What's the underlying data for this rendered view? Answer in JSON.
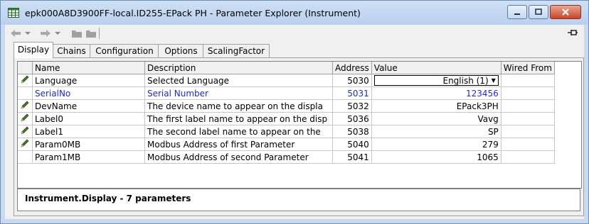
{
  "window": {
    "title": "epk000A8D3900FF-local.ID255-EPack  PH - Parameter Explorer (Instrument)"
  },
  "toolbar": {
    "icons": [
      "back-arrow-icon",
      "dropdown-arrow-icon",
      "forward-arrow-icon",
      "dropdown-arrow-icon",
      "folder-up-icon",
      "folder-icon",
      "pin-icon"
    ]
  },
  "tabs": [
    {
      "label": "Display",
      "active": true
    },
    {
      "label": "Chains"
    },
    {
      "label": "Configuration"
    },
    {
      "label": "Options"
    },
    {
      "label": "ScalingFactor"
    }
  ],
  "grid": {
    "columns": [
      "",
      "Name",
      "Description",
      "Address",
      "Value",
      "Wired From"
    ],
    "rows": [
      {
        "editable": true,
        "name": "Language",
        "description": "Selected Language",
        "address": "5030",
        "value": "English (1)",
        "wired_from": ""
      },
      {
        "editable": false,
        "name": "SerialNo",
        "description": "Serial Number",
        "address": "5031",
        "value": "123456",
        "wired_from": ""
      },
      {
        "editable": true,
        "name": "DevName",
        "description": "The device name to appear on the displa",
        "address": "5032",
        "value": "EPack3PH",
        "wired_from": ""
      },
      {
        "editable": true,
        "name": "Label0",
        "description": "The first label name to appear on the disp",
        "address": "5036",
        "value": "Vavg",
        "wired_from": ""
      },
      {
        "editable": true,
        "name": "Label1",
        "description": "The second label name to appear on the",
        "address": "5038",
        "value": "SP",
        "wired_from": ""
      },
      {
        "editable": true,
        "name": "Param0MB",
        "description": "Modbus Address of first Parameter",
        "address": "5040",
        "value": "279",
        "wired_from": ""
      },
      {
        "editable": false,
        "name": "Param1MB",
        "description": "Modbus Address of second Parameter",
        "address": "5041",
        "value": "1065",
        "wired_from": ""
      }
    ]
  },
  "status": {
    "text": "Instrument.Display  -  7 parameters"
  },
  "colors": {
    "readonly_text": "#1e2bd0",
    "pencil": "#4a7d22"
  }
}
